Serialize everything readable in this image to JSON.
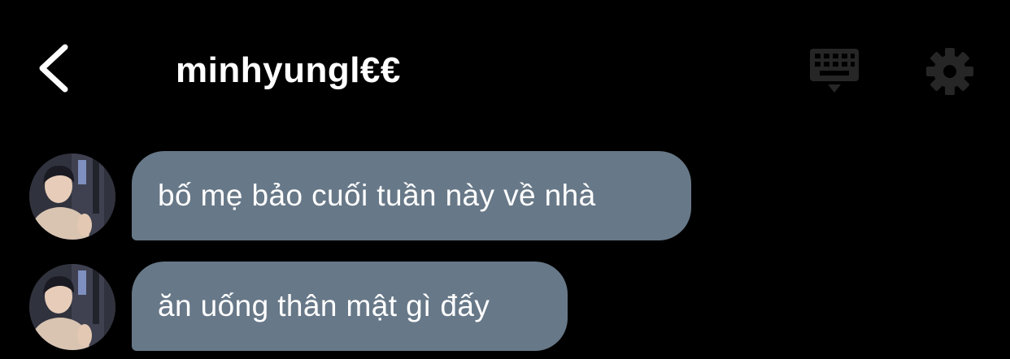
{
  "header": {
    "title": "minhyungl€€",
    "back_icon": "chevron-left-icon",
    "keyboard_icon": "keyboard-icon",
    "settings_icon": "gear-icon"
  },
  "messages": [
    {
      "text": "bố mẹ bảo cuối tuần này về nhà"
    },
    {
      "text": "ăn uống thân mật gì đấy"
    }
  ],
  "colors": {
    "background": "#000000",
    "bubble": "#677888",
    "text": "#ffffff",
    "dim_icon": "#262626"
  }
}
